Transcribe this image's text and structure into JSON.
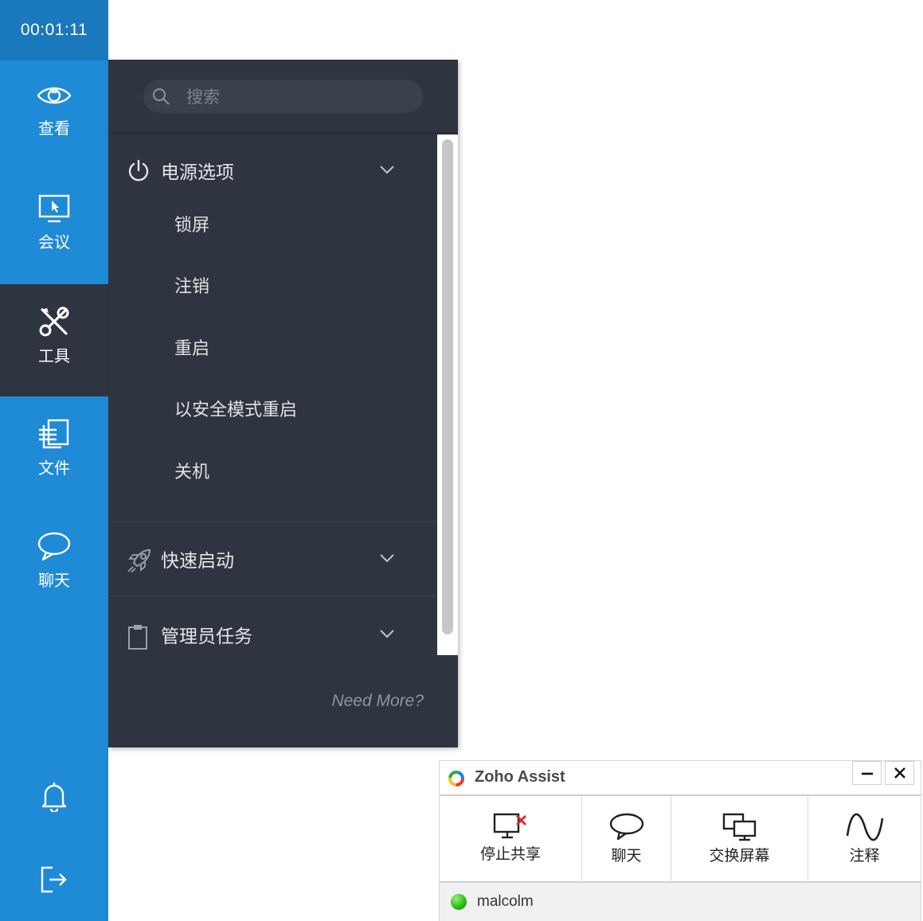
{
  "sidebar": {
    "timer": "00:01:11",
    "items": [
      {
        "label": "查看",
        "icon": "eye-icon"
      },
      {
        "label": "会议",
        "icon": "monitor-cursor-icon"
      },
      {
        "label": "工具",
        "icon": "tools-icon",
        "active": true
      },
      {
        "label": "文件",
        "icon": "files-icon"
      },
      {
        "label": "聊天",
        "icon": "chat-bubble-icon"
      }
    ],
    "bottom_icons": [
      "bell-icon",
      "logout-icon"
    ]
  },
  "tools_panel": {
    "search_placeholder": "搜索",
    "sections": [
      {
        "title": "电源选项",
        "icon": "power-icon",
        "expanded": true,
        "items": [
          "锁屏",
          "注销",
          "重启",
          "以安全模式重启",
          "关机"
        ]
      },
      {
        "title": "快速启动",
        "icon": "rocket-icon",
        "expanded": false
      },
      {
        "title": "管理员任务",
        "icon": "clipboard-icon",
        "expanded": false
      }
    ],
    "need_more": "Need More?"
  },
  "zoho_assist": {
    "title": "Zoho Assist",
    "actions": [
      {
        "label": "停止共享",
        "icon": "stop-share-icon"
      },
      {
        "label": "聊天",
        "icon": "chat-icon"
      },
      {
        "label": "交换屏幕",
        "icon": "switch-screen-icon"
      },
      {
        "label": "注释",
        "icon": "annotate-icon"
      }
    ],
    "user": "malcolm",
    "colors": {
      "status_online": "#2db514",
      "stop_red": "#e0282e"
    }
  },
  "colors": {
    "sidebar_blue": "#1f8ad6",
    "timer_blue": "#1a78bd",
    "panel_dark": "#2e3540"
  }
}
